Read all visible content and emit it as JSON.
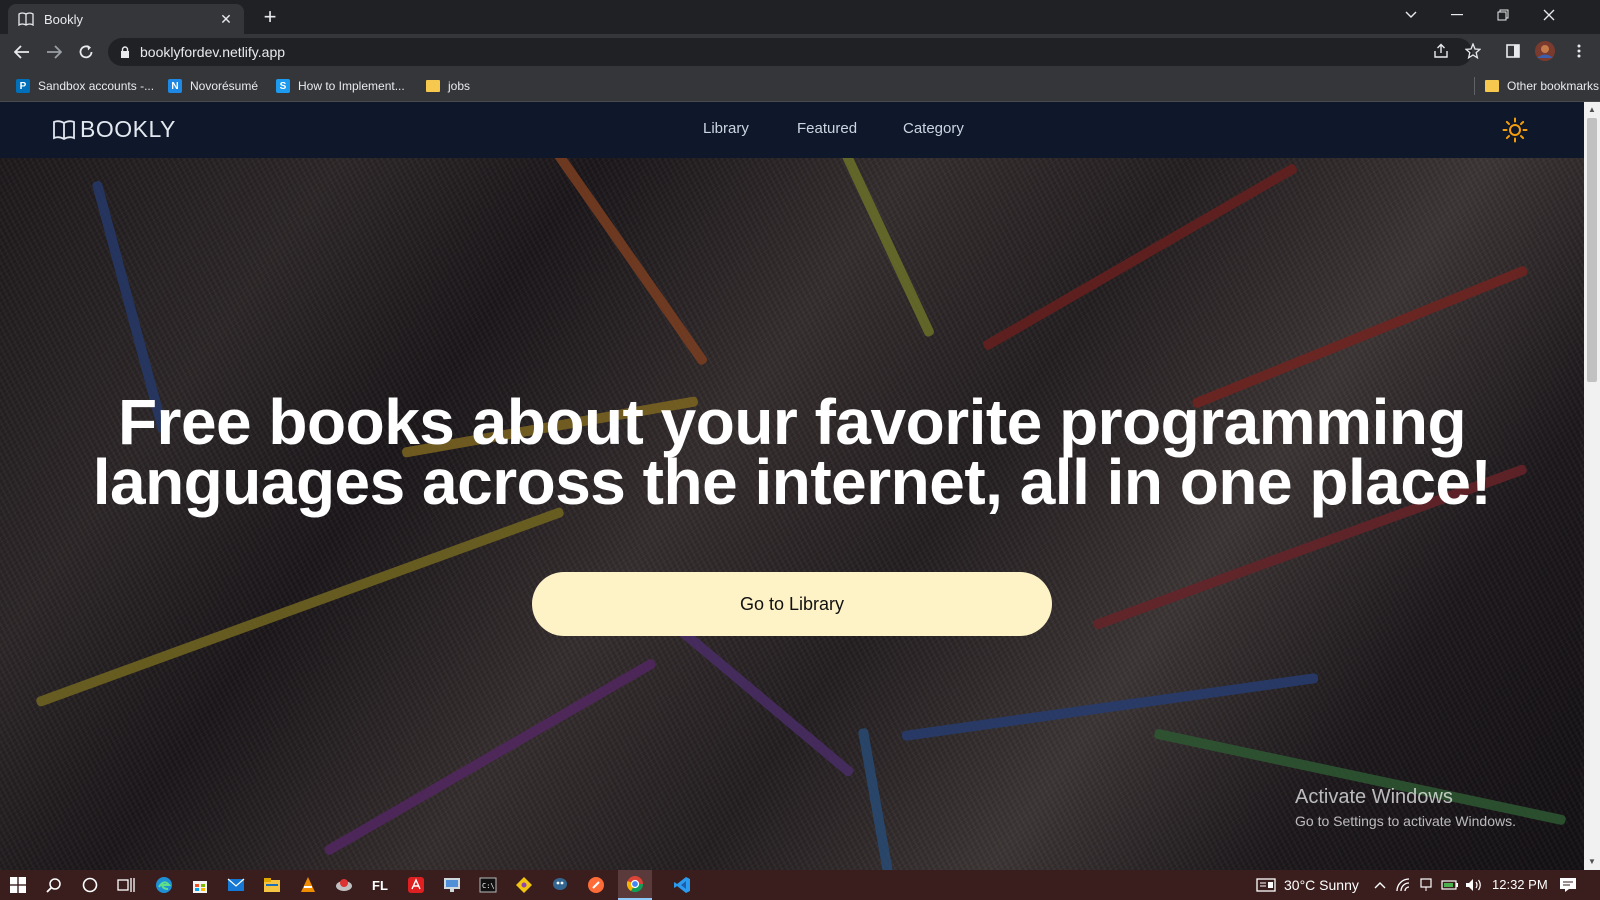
{
  "browser": {
    "tab_title": "Bookly",
    "url": "booklyfordev.netlify.app"
  },
  "bookmarks": [
    {
      "label": "Sandbox accounts -...",
      "icon": "paypal-icon",
      "color": "#0070ba"
    },
    {
      "label": "Novorésumé",
      "icon": "novoresume-icon",
      "color": "#1e88e5"
    },
    {
      "label": "How to Implement...",
      "icon": "s-icon",
      "color": "#1d9bf0"
    },
    {
      "label": "jobs",
      "icon": "folder-icon",
      "color": "#f6c94e"
    }
  ],
  "other_bookmarks": "Other bookmarks",
  "site": {
    "brand": "BOOKLY",
    "nav": [
      "Library",
      "Featured",
      "Category"
    ],
    "theme_icon": "sun-icon",
    "headline_line1": "Free books about your favorite programming",
    "headline_line2": "languages across the internet, all in one place!",
    "cta_label": "Go to Library"
  },
  "watermark": {
    "title": "Activate Windows",
    "subtitle": "Go to Settings to activate Windows."
  },
  "taskbar": {
    "weather": "30°C  Sunny",
    "time": "12:32 PM"
  },
  "colors": {
    "nav_bg": "#0f172a",
    "cta_bg": "#fef3c7",
    "taskbar_bg": "#3a1e1e"
  }
}
